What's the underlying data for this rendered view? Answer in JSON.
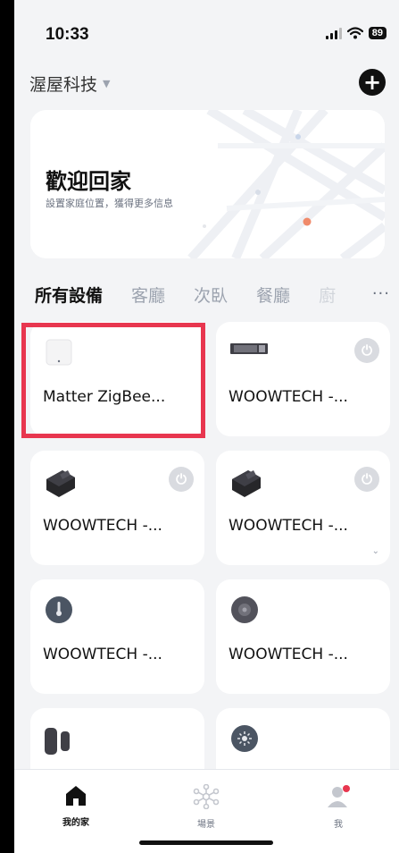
{
  "status_bar": {
    "time": "10:33",
    "battery": "89"
  },
  "header": {
    "home_name": "渥屋科技",
    "caret": "▼",
    "add_icon": "plus-circle-icon"
  },
  "welcome_card": {
    "title": "歡迎回家",
    "subtitle": "設置家庭位置，獲得更多信息"
  },
  "tabs": [
    {
      "label": "所有設備",
      "active": true
    },
    {
      "label": "客廳",
      "active": false
    },
    {
      "label": "次臥",
      "active": false
    },
    {
      "label": "餐廳",
      "active": false
    },
    {
      "label": "廚",
      "active": false
    }
  ],
  "more_label": "···",
  "devices": [
    {
      "name": "Matter ZigBee...",
      "icon": "zigbee-hub-icon",
      "has_power": false
    },
    {
      "name": "WOOWTECH -...",
      "icon": "led-driver-icon",
      "has_power": true
    },
    {
      "name": "WOOWTECH -...",
      "icon": "din-module-icon",
      "has_power": true
    },
    {
      "name": "WOOWTECH -...",
      "icon": "din-module-icon",
      "has_power": true
    },
    {
      "name": "WOOWTECH -...",
      "icon": "temperature-sensor-icon",
      "has_power": false
    },
    {
      "name": "WOOWTECH -...",
      "icon": "round-sensor-icon",
      "has_power": false
    },
    {
      "name": "",
      "icon": "door-sensor-icon",
      "has_power": false
    },
    {
      "name": "",
      "icon": "light-sensor-icon",
      "has_power": false
    }
  ],
  "power_glyph": "⏻",
  "chevron_glyph": "⌄",
  "nav": [
    {
      "label": "我的家",
      "icon": "home-icon",
      "active": true
    },
    {
      "label": "場景",
      "icon": "scene-icon",
      "active": false
    },
    {
      "label": "我",
      "icon": "user-icon",
      "active": false
    }
  ],
  "colors": {
    "highlight": "#e8364f",
    "accent_dot": "#f08a6a",
    "badge": "#e8364f"
  }
}
